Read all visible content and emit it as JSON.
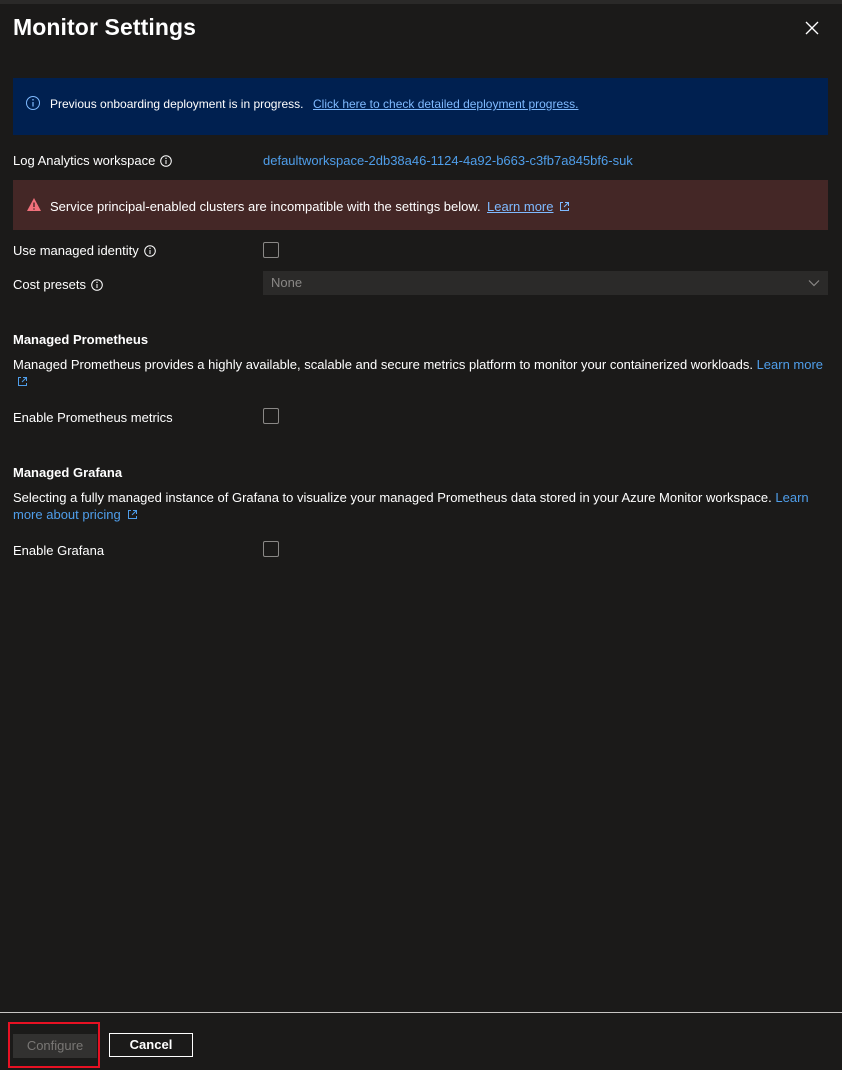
{
  "dialog": {
    "title": "Monitor Settings",
    "close_icon": "close-icon"
  },
  "info_banner": {
    "message": "Previous onboarding deployment is in progress.",
    "link": "Click here to check detailed deployment progress.",
    "icon": "info-icon"
  },
  "log_analytics": {
    "label": "Log Analytics workspace",
    "value": "defaultworkspace-2db38a46-1124-4a92-b663-c3fb7a845bf6-suk"
  },
  "error_banner": {
    "message": "Service principal-enabled clusters are incompatible with the settings below.",
    "link": "Learn more",
    "icon": "warning-icon"
  },
  "managed_identity": {
    "label": "Use managed identity",
    "checked": false
  },
  "cost_presets": {
    "label": "Cost presets",
    "value": "None"
  },
  "prometheus": {
    "heading": "Managed Prometheus",
    "description": "Managed Prometheus provides a highly available, scalable and secure metrics platform to monitor your containerized workloads.",
    "link": "Learn more",
    "enable_label": "Enable Prometheus metrics",
    "checked": false
  },
  "grafana": {
    "heading": "Managed Grafana",
    "description": "Selecting a fully managed instance of Grafana to visualize your managed Prometheus data stored in your Azure Monitor workspace.",
    "link": "Learn more about pricing",
    "enable_label": "Enable Grafana",
    "checked": false
  },
  "footer": {
    "configure_label": "Configure",
    "cancel_label": "Cancel"
  },
  "colors": {
    "background": "#1b1a19",
    "info_banner": "#002050",
    "error_banner": "#442726",
    "link": "#4f9eea",
    "highlight": "#e81123"
  }
}
